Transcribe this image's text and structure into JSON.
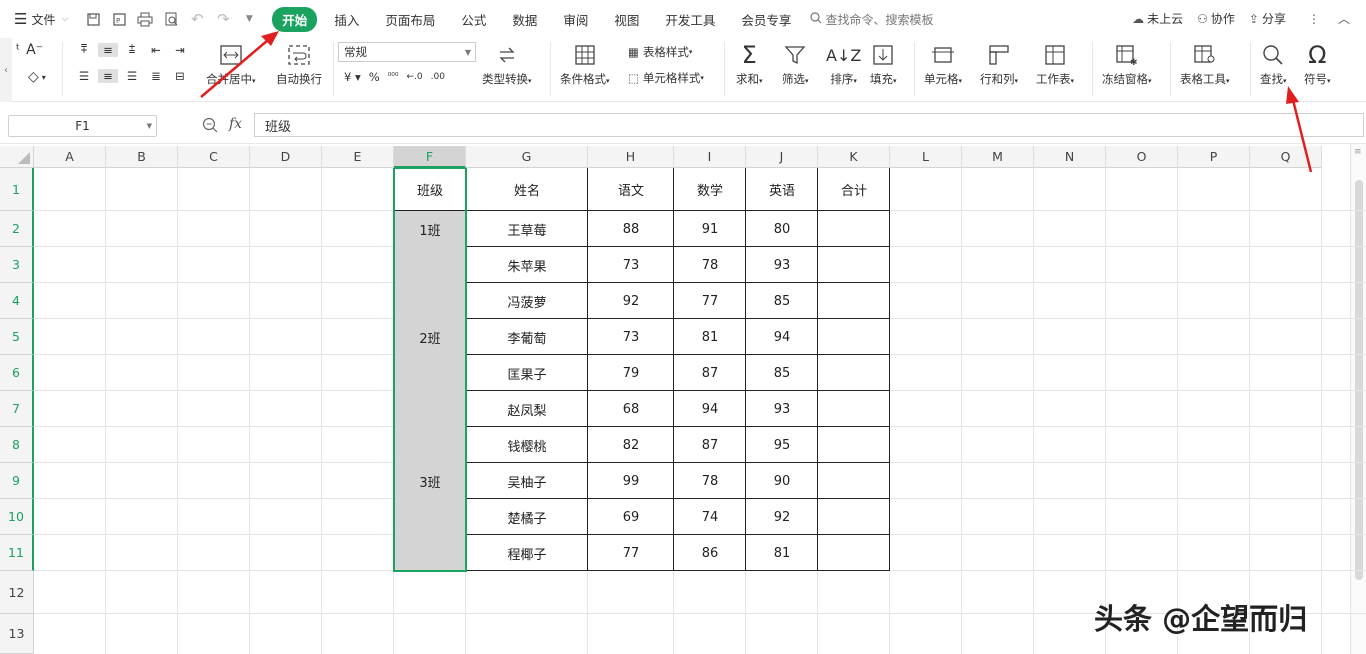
{
  "menu": {
    "file": "文件",
    "tabs": [
      "开始",
      "插入",
      "页面布局",
      "公式",
      "数据",
      "审阅",
      "视图",
      "开发工具",
      "会员专享"
    ],
    "search_placeholder": "查找命令、搜索模板",
    "right": {
      "cloud": "未上云",
      "collab": "协作",
      "share": "分享"
    }
  },
  "ribbon": {
    "merge": "合并居中",
    "wrap": "自动换行",
    "number_format": "常规",
    "convert": "类型转换",
    "cond_format": "条件格式",
    "table_style": "表格样式",
    "cell_style": "单元格样式",
    "sum": "求和",
    "filter": "筛选",
    "sort": "排序",
    "fill": "填充",
    "cell": "单元格",
    "rowcol": "行和列",
    "sheet": "工作表",
    "freeze": "冻结窗格",
    "tools": "表格工具",
    "find": "查找",
    "symbol": "符号"
  },
  "formula_bar": {
    "name_box": "F1",
    "fx": "fx",
    "value": "班级"
  },
  "columns": [
    "A",
    "B",
    "C",
    "D",
    "E",
    "F",
    "G",
    "H",
    "I",
    "J",
    "K",
    "L",
    "M",
    "N",
    "O",
    "P",
    "Q"
  ],
  "rows": [
    "1",
    "2",
    "3",
    "4",
    "5",
    "6",
    "7",
    "8",
    "9",
    "10",
    "11",
    "12",
    "13"
  ],
  "table": {
    "headers": [
      "班级",
      "姓名",
      "语文",
      "数学",
      "英语",
      "合计"
    ],
    "records": [
      [
        "1班",
        "王草莓",
        "88",
        "91",
        "80",
        ""
      ],
      [
        "",
        "朱苹果",
        "73",
        "78",
        "93",
        ""
      ],
      [
        "",
        "冯菠萝",
        "92",
        "77",
        "85",
        ""
      ],
      [
        "2班",
        "李葡萄",
        "73",
        "81",
        "94",
        ""
      ],
      [
        "",
        "匡果子",
        "79",
        "87",
        "85",
        ""
      ],
      [
        "",
        "赵凤梨",
        "68",
        "94",
        "93",
        ""
      ],
      [
        "",
        "钱樱桃",
        "82",
        "87",
        "95",
        ""
      ],
      [
        "3班",
        "吴柚子",
        "99",
        "78",
        "90",
        ""
      ],
      [
        "",
        "楚橘子",
        "69",
        "74",
        "92",
        ""
      ],
      [
        "",
        "程椰子",
        "77",
        "86",
        "81",
        ""
      ]
    ]
  },
  "watermark": "头条 @企望而归",
  "colors": {
    "accent": "#1aa260",
    "arrow": "#e02020",
    "selected_fill": "#d4d4d4"
  }
}
